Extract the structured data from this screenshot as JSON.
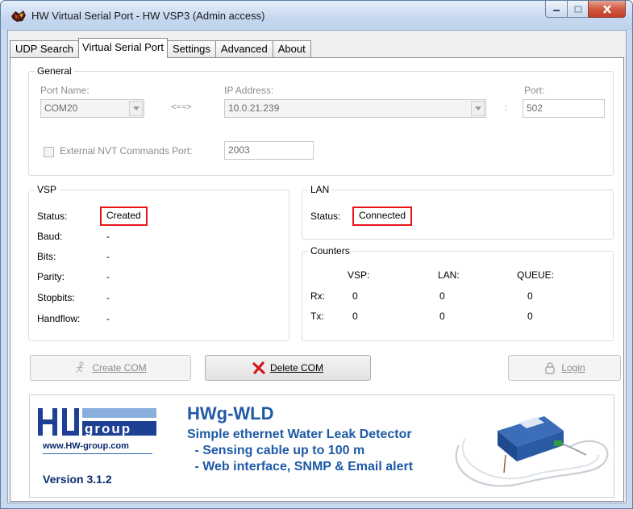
{
  "window": {
    "title": "HW Virtual Serial Port - HW VSP3 (Admin access)"
  },
  "tabs": [
    {
      "label": "UDP Search"
    },
    {
      "label": "Virtual Serial Port"
    },
    {
      "label": "Settings"
    },
    {
      "label": "Advanced"
    },
    {
      "label": "About"
    }
  ],
  "general": {
    "title": "General",
    "port_name_label": "Port Name:",
    "port_name_value": "COM20",
    "arrow": "<==>",
    "ip_label": "IP Address:",
    "ip_value": "10.0.21.239",
    "colon": ":",
    "port_label": "Port:",
    "port_value": "502",
    "nvt_label": "External NVT Commands Port:",
    "nvt_value": "2003"
  },
  "vsp": {
    "title": "VSP",
    "rows": [
      {
        "label": "Status:",
        "value": "Created"
      },
      {
        "label": "Baud:",
        "value": "-"
      },
      {
        "label": "Bits:",
        "value": "-"
      },
      {
        "label": "Parity:",
        "value": "-"
      },
      {
        "label": "Stopbits:",
        "value": "-"
      },
      {
        "label": "Handflow:",
        "value": "-"
      }
    ]
  },
  "lan": {
    "title": "LAN",
    "status_label": "Status:",
    "status_value": "Connected"
  },
  "counters": {
    "title": "Counters",
    "headers": [
      "VSP:",
      "LAN:",
      "QUEUE:"
    ],
    "rows": [
      {
        "label": "Rx:",
        "values": [
          "0",
          "0",
          "0"
        ]
      },
      {
        "label": "Tx:",
        "values": [
          "0",
          "0",
          "0"
        ]
      }
    ]
  },
  "buttons": {
    "create_com": "Create COM",
    "delete_com": "Delete COM",
    "login": "Login"
  },
  "banner": {
    "logo_text": "group",
    "url": "www.HW-group.com",
    "version": "Version  3.1.2",
    "product_title": "HWg-WLD",
    "lines": [
      "Simple ethernet Water Leak Detector",
      " - Sensing cable up to 100 m",
      " - Web interface, SNMP & Email alert"
    ]
  },
  "colors": {
    "highlight": "#e8141b",
    "brand_blue": "#1f5aa6",
    "delete_icon": "#d4141b"
  }
}
